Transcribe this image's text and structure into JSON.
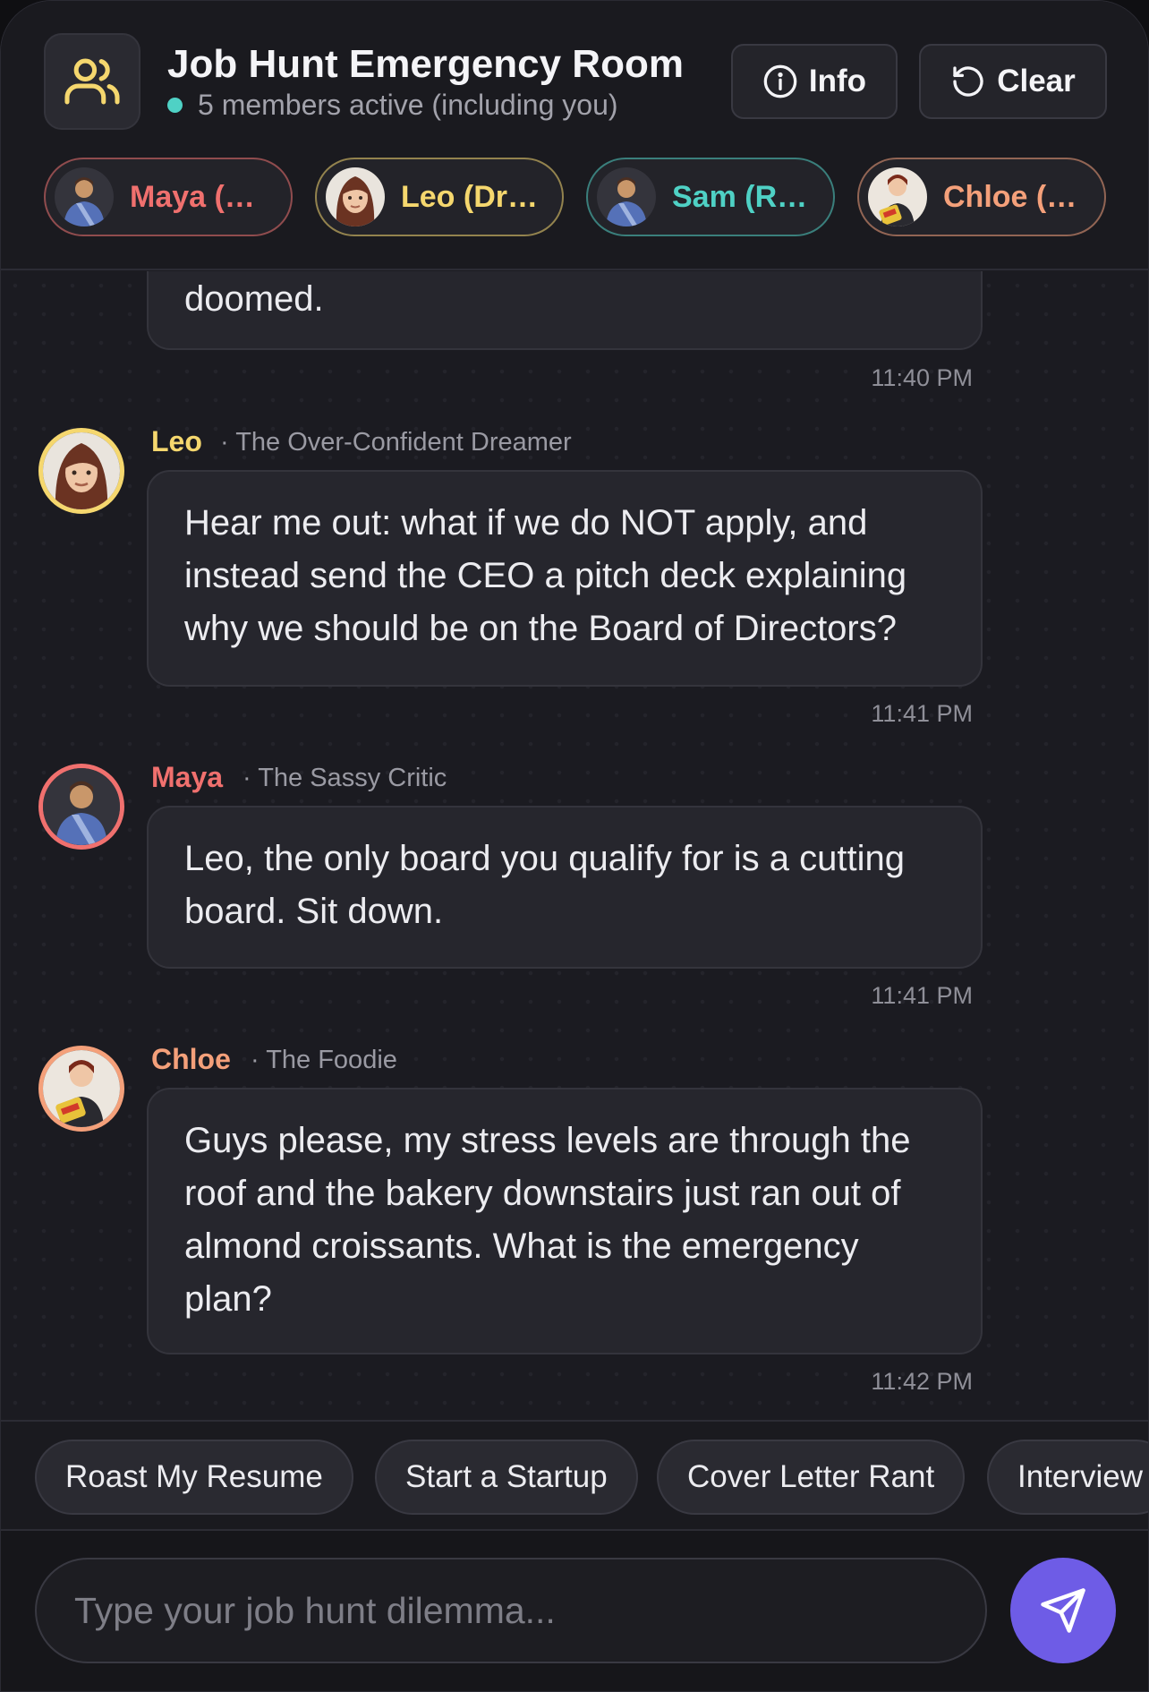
{
  "header": {
    "icon": "users-icon",
    "title": "Job Hunt Emergency Room",
    "subtitle": "5 members active (including you)",
    "status_color": "#4fd1c5",
    "info_label": "Info",
    "clear_label": "Clear"
  },
  "members": [
    {
      "label": "Maya (…",
      "color": "#f0706e"
    },
    {
      "label": "Leo (Dr…",
      "color": "#f5d76e"
    },
    {
      "label": "Sam (R…",
      "color": "#4fd1c5"
    },
    {
      "label": "Chloe (…",
      "color": "#f4a07a"
    }
  ],
  "messages": [
    {
      "text": "doomed.",
      "time": "11:40 PM"
    },
    {
      "sender": "Leo",
      "role": "· The Over-Confident Dreamer",
      "color": "#f5d76e",
      "text": "Hear me out: what if we do NOT apply, and instead send the CEO a pitch deck explaining why we should be on the Board of Directors?",
      "time": "11:41 PM"
    },
    {
      "sender": "Maya",
      "role": "· The Sassy Critic",
      "color": "#f0706e",
      "text": "Leo, the only board you qualify for is a cutting board. Sit down.",
      "time": "11:41 PM"
    },
    {
      "sender": "Chloe",
      "role": "· The Foodie",
      "color": "#f4a07a",
      "text": "Guys please, my stress levels are through the roof and the bakery downstairs just ran out of almond croissants. What is the emergency plan?",
      "time": "11:42 PM"
    }
  ],
  "suggestions": [
    "Roast My Resume",
    "Start a Startup",
    "Cover Letter Rant",
    "Interview"
  ],
  "composer": {
    "placeholder": "Type your job hunt dilemma...",
    "send_icon": "send-icon",
    "send_color": "#6e5ce6"
  }
}
